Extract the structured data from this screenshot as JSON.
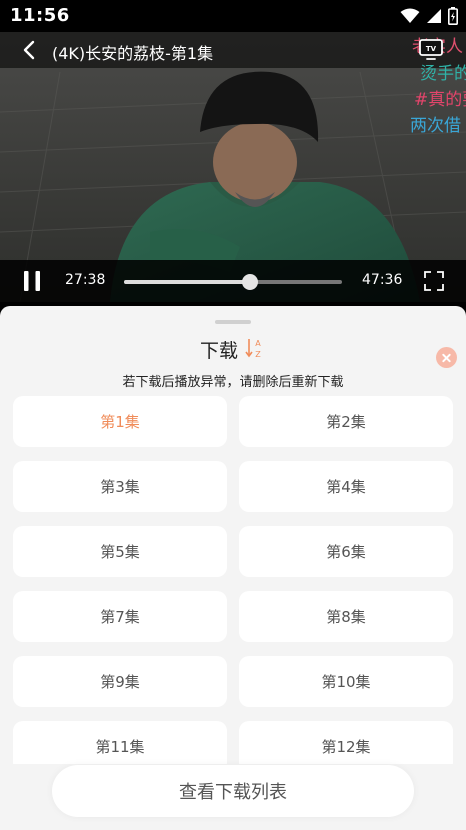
{
  "status_bar": {
    "time": "11:56",
    "icons": [
      "wifi-icon",
      "cell-signal-icon",
      "battery-icon"
    ]
  },
  "player": {
    "title": "(4K)长安的荔枝-第1集",
    "current_time": "27:38",
    "total_time": "47:36",
    "progress_fraction": 0.58,
    "danmaku": [
      "老实人",
      "烫手的",
      "#真的要",
      "两次借"
    ],
    "tv_cast_icon_label": "TV",
    "icons": [
      "back-icon",
      "tv-cast-icon",
      "pause-icon",
      "fullscreen-icon"
    ]
  },
  "download_sheet": {
    "title": "下载",
    "sort_letters": [
      "A",
      "Z"
    ],
    "hint": "若下载后播放异常，请删除后重新下载",
    "episodes": [
      {
        "label": "第1集",
        "selected": true
      },
      {
        "label": "第2集",
        "selected": false
      },
      {
        "label": "第3集",
        "selected": false
      },
      {
        "label": "第4集",
        "selected": false
      },
      {
        "label": "第5集",
        "selected": false
      },
      {
        "label": "第6集",
        "selected": false
      },
      {
        "label": "第7集",
        "selected": false
      },
      {
        "label": "第8集",
        "selected": false
      },
      {
        "label": "第9集",
        "selected": false
      },
      {
        "label": "第10集",
        "selected": false
      },
      {
        "label": "第11集",
        "selected": false
      },
      {
        "label": "第12集",
        "selected": false
      }
    ],
    "view_list_button": "查看下载列表"
  },
  "colors": {
    "accent": "#f08c5a",
    "sheet_background": "#f4f4f4",
    "close_button": "#f7b9a8"
  }
}
